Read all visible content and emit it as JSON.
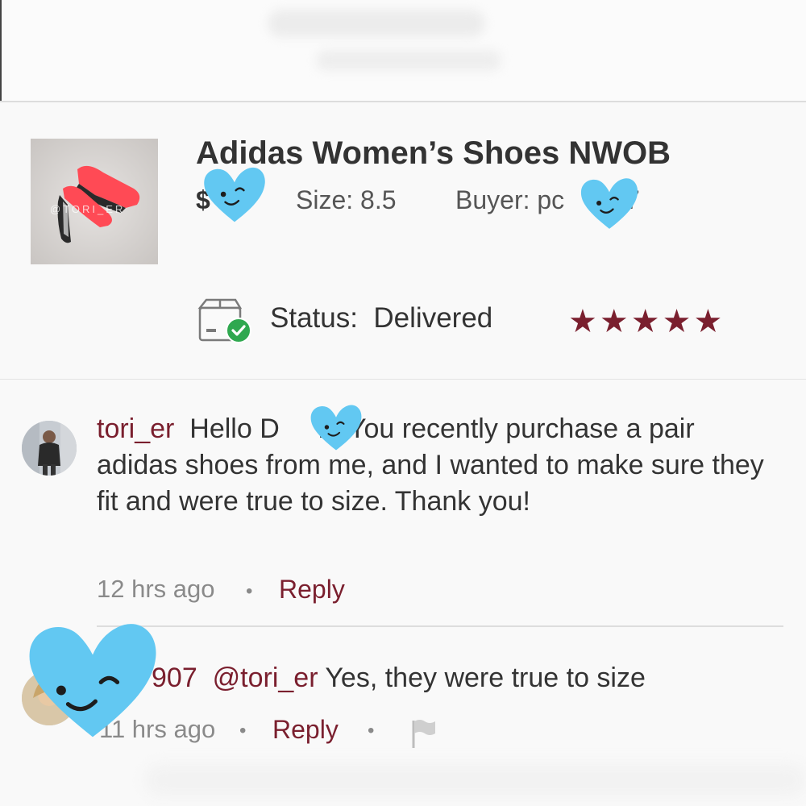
{
  "product": {
    "title": "Adidas Women’s Shoes NWOB",
    "price": "$",
    "size": "Size: 8.5",
    "buyer": "Buyer: pc",
    "buyer_tail": "07",
    "watermark": "@TORI_ER"
  },
  "status": {
    "label": "Status:",
    "value": "Delivered",
    "rating_stars": "★★★★★",
    "rating": 5
  },
  "comments": [
    {
      "username": "tori_er",
      "text_before": "Hello D",
      "text_after": "n! You recently purchase a pair adidas shoes from me, and I wanted to make sure they fit and were true to size. Thank you!",
      "time": "12 hrs ago",
      "reply": "Reply"
    },
    {
      "username_partial": "907",
      "mention": "@tori_er",
      "text": "Yes, they were true to size",
      "time": "11 hrs ago",
      "reply": "Reply"
    }
  ],
  "separator": "•",
  "colors": {
    "accent": "#7a1f2e",
    "heart": "#62c8f2",
    "check": "#2fa84f"
  },
  "icons": [
    "box-delivered-icon",
    "star-icon",
    "flag-icon",
    "heart-sticker"
  ]
}
